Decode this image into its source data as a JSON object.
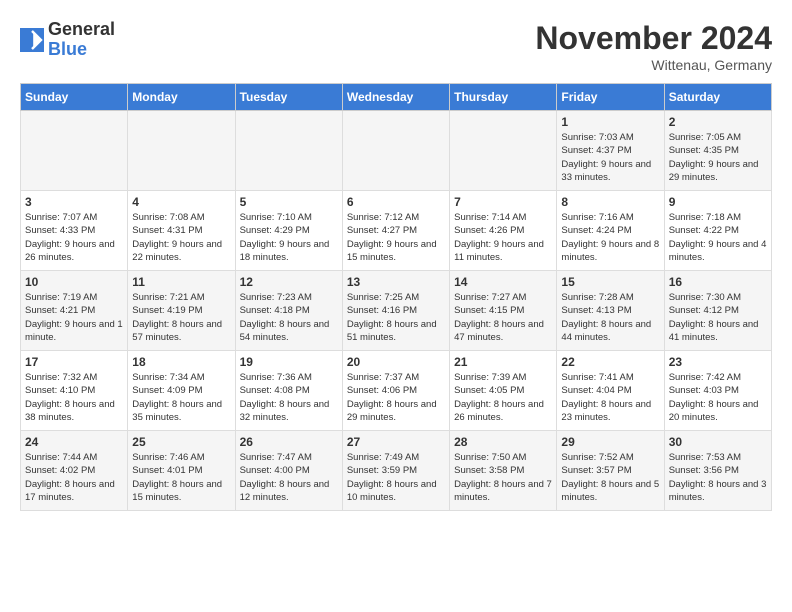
{
  "header": {
    "logo_general": "General",
    "logo_blue": "Blue",
    "month_title": "November 2024",
    "location": "Wittenau, Germany"
  },
  "days_of_week": [
    "Sunday",
    "Monday",
    "Tuesday",
    "Wednesday",
    "Thursday",
    "Friday",
    "Saturday"
  ],
  "weeks": [
    [
      {
        "day": "",
        "info": ""
      },
      {
        "day": "",
        "info": ""
      },
      {
        "day": "",
        "info": ""
      },
      {
        "day": "",
        "info": ""
      },
      {
        "day": "",
        "info": ""
      },
      {
        "day": "1",
        "info": "Sunrise: 7:03 AM\nSunset: 4:37 PM\nDaylight: 9 hours and 33 minutes."
      },
      {
        "day": "2",
        "info": "Sunrise: 7:05 AM\nSunset: 4:35 PM\nDaylight: 9 hours and 29 minutes."
      }
    ],
    [
      {
        "day": "3",
        "info": "Sunrise: 7:07 AM\nSunset: 4:33 PM\nDaylight: 9 hours and 26 minutes."
      },
      {
        "day": "4",
        "info": "Sunrise: 7:08 AM\nSunset: 4:31 PM\nDaylight: 9 hours and 22 minutes."
      },
      {
        "day": "5",
        "info": "Sunrise: 7:10 AM\nSunset: 4:29 PM\nDaylight: 9 hours and 18 minutes."
      },
      {
        "day": "6",
        "info": "Sunrise: 7:12 AM\nSunset: 4:27 PM\nDaylight: 9 hours and 15 minutes."
      },
      {
        "day": "7",
        "info": "Sunrise: 7:14 AM\nSunset: 4:26 PM\nDaylight: 9 hours and 11 minutes."
      },
      {
        "day": "8",
        "info": "Sunrise: 7:16 AM\nSunset: 4:24 PM\nDaylight: 9 hours and 8 minutes."
      },
      {
        "day": "9",
        "info": "Sunrise: 7:18 AM\nSunset: 4:22 PM\nDaylight: 9 hours and 4 minutes."
      }
    ],
    [
      {
        "day": "10",
        "info": "Sunrise: 7:19 AM\nSunset: 4:21 PM\nDaylight: 9 hours and 1 minute."
      },
      {
        "day": "11",
        "info": "Sunrise: 7:21 AM\nSunset: 4:19 PM\nDaylight: 8 hours and 57 minutes."
      },
      {
        "day": "12",
        "info": "Sunrise: 7:23 AM\nSunset: 4:18 PM\nDaylight: 8 hours and 54 minutes."
      },
      {
        "day": "13",
        "info": "Sunrise: 7:25 AM\nSunset: 4:16 PM\nDaylight: 8 hours and 51 minutes."
      },
      {
        "day": "14",
        "info": "Sunrise: 7:27 AM\nSunset: 4:15 PM\nDaylight: 8 hours and 47 minutes."
      },
      {
        "day": "15",
        "info": "Sunrise: 7:28 AM\nSunset: 4:13 PM\nDaylight: 8 hours and 44 minutes."
      },
      {
        "day": "16",
        "info": "Sunrise: 7:30 AM\nSunset: 4:12 PM\nDaylight: 8 hours and 41 minutes."
      }
    ],
    [
      {
        "day": "17",
        "info": "Sunrise: 7:32 AM\nSunset: 4:10 PM\nDaylight: 8 hours and 38 minutes."
      },
      {
        "day": "18",
        "info": "Sunrise: 7:34 AM\nSunset: 4:09 PM\nDaylight: 8 hours and 35 minutes."
      },
      {
        "day": "19",
        "info": "Sunrise: 7:36 AM\nSunset: 4:08 PM\nDaylight: 8 hours and 32 minutes."
      },
      {
        "day": "20",
        "info": "Sunrise: 7:37 AM\nSunset: 4:06 PM\nDaylight: 8 hours and 29 minutes."
      },
      {
        "day": "21",
        "info": "Sunrise: 7:39 AM\nSunset: 4:05 PM\nDaylight: 8 hours and 26 minutes."
      },
      {
        "day": "22",
        "info": "Sunrise: 7:41 AM\nSunset: 4:04 PM\nDaylight: 8 hours and 23 minutes."
      },
      {
        "day": "23",
        "info": "Sunrise: 7:42 AM\nSunset: 4:03 PM\nDaylight: 8 hours and 20 minutes."
      }
    ],
    [
      {
        "day": "24",
        "info": "Sunrise: 7:44 AM\nSunset: 4:02 PM\nDaylight: 8 hours and 17 minutes."
      },
      {
        "day": "25",
        "info": "Sunrise: 7:46 AM\nSunset: 4:01 PM\nDaylight: 8 hours and 15 minutes."
      },
      {
        "day": "26",
        "info": "Sunrise: 7:47 AM\nSunset: 4:00 PM\nDaylight: 8 hours and 12 minutes."
      },
      {
        "day": "27",
        "info": "Sunrise: 7:49 AM\nSunset: 3:59 PM\nDaylight: 8 hours and 10 minutes."
      },
      {
        "day": "28",
        "info": "Sunrise: 7:50 AM\nSunset: 3:58 PM\nDaylight: 8 hours and 7 minutes."
      },
      {
        "day": "29",
        "info": "Sunrise: 7:52 AM\nSunset: 3:57 PM\nDaylight: 8 hours and 5 minutes."
      },
      {
        "day": "30",
        "info": "Sunrise: 7:53 AM\nSunset: 3:56 PM\nDaylight: 8 hours and 3 minutes."
      }
    ]
  ]
}
